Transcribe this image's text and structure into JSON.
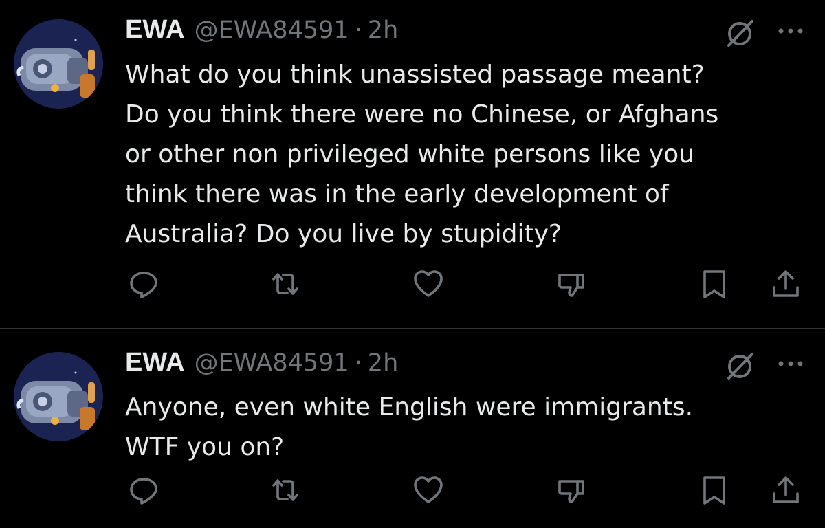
{
  "colors": {
    "background": "#000000",
    "primary_text": "#e7e9ea",
    "secondary_text": "#71767b",
    "divider": "#2f3336"
  },
  "tweets": [
    {
      "author": {
        "name": "EWA",
        "handle": "@EWA84591"
      },
      "separator": "·",
      "time": "2h",
      "text_lines": [
        "What do you think unassisted passage meant?",
        "Do you think there were no Chinese, or Afghans",
        "or other non privileged white persons like you",
        "think there was in the early development of",
        "Australia?  Do you live by stupidity?"
      ],
      "icons": [
        "grok-icon",
        "more-icon",
        "reply-icon",
        "retweet-icon",
        "like-icon",
        "dislike-icon",
        "bookmark-icon",
        "share-icon"
      ]
    },
    {
      "author": {
        "name": "EWA",
        "handle": "@EWA84591"
      },
      "separator": "·",
      "time": "2h",
      "text_lines": [
        "Anyone, even white English were immigrants.",
        "WTF you on?"
      ],
      "icons": [
        "grok-icon",
        "more-icon",
        "reply-icon",
        "retweet-icon",
        "like-icon",
        "dislike-icon",
        "bookmark-icon",
        "share-icon"
      ]
    }
  ]
}
